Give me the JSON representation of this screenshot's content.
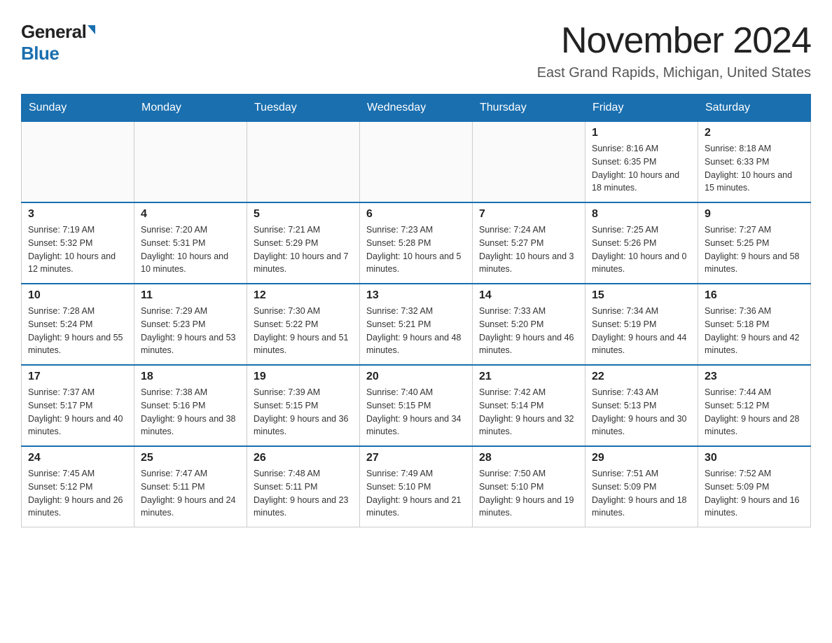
{
  "logo": {
    "general": "General",
    "blue": "Blue"
  },
  "title": "November 2024",
  "subtitle": "East Grand Rapids, Michigan, United States",
  "days_of_week": [
    "Sunday",
    "Monday",
    "Tuesday",
    "Wednesday",
    "Thursday",
    "Friday",
    "Saturday"
  ],
  "weeks": [
    [
      {
        "day": "",
        "info": ""
      },
      {
        "day": "",
        "info": ""
      },
      {
        "day": "",
        "info": ""
      },
      {
        "day": "",
        "info": ""
      },
      {
        "day": "",
        "info": ""
      },
      {
        "day": "1",
        "info": "Sunrise: 8:16 AM\nSunset: 6:35 PM\nDaylight: 10 hours and 18 minutes."
      },
      {
        "day": "2",
        "info": "Sunrise: 8:18 AM\nSunset: 6:33 PM\nDaylight: 10 hours and 15 minutes."
      }
    ],
    [
      {
        "day": "3",
        "info": "Sunrise: 7:19 AM\nSunset: 5:32 PM\nDaylight: 10 hours and 12 minutes."
      },
      {
        "day": "4",
        "info": "Sunrise: 7:20 AM\nSunset: 5:31 PM\nDaylight: 10 hours and 10 minutes."
      },
      {
        "day": "5",
        "info": "Sunrise: 7:21 AM\nSunset: 5:29 PM\nDaylight: 10 hours and 7 minutes."
      },
      {
        "day": "6",
        "info": "Sunrise: 7:23 AM\nSunset: 5:28 PM\nDaylight: 10 hours and 5 minutes."
      },
      {
        "day": "7",
        "info": "Sunrise: 7:24 AM\nSunset: 5:27 PM\nDaylight: 10 hours and 3 minutes."
      },
      {
        "day": "8",
        "info": "Sunrise: 7:25 AM\nSunset: 5:26 PM\nDaylight: 10 hours and 0 minutes."
      },
      {
        "day": "9",
        "info": "Sunrise: 7:27 AM\nSunset: 5:25 PM\nDaylight: 9 hours and 58 minutes."
      }
    ],
    [
      {
        "day": "10",
        "info": "Sunrise: 7:28 AM\nSunset: 5:24 PM\nDaylight: 9 hours and 55 minutes."
      },
      {
        "day": "11",
        "info": "Sunrise: 7:29 AM\nSunset: 5:23 PM\nDaylight: 9 hours and 53 minutes."
      },
      {
        "day": "12",
        "info": "Sunrise: 7:30 AM\nSunset: 5:22 PM\nDaylight: 9 hours and 51 minutes."
      },
      {
        "day": "13",
        "info": "Sunrise: 7:32 AM\nSunset: 5:21 PM\nDaylight: 9 hours and 48 minutes."
      },
      {
        "day": "14",
        "info": "Sunrise: 7:33 AM\nSunset: 5:20 PM\nDaylight: 9 hours and 46 minutes."
      },
      {
        "day": "15",
        "info": "Sunrise: 7:34 AM\nSunset: 5:19 PM\nDaylight: 9 hours and 44 minutes."
      },
      {
        "day": "16",
        "info": "Sunrise: 7:36 AM\nSunset: 5:18 PM\nDaylight: 9 hours and 42 minutes."
      }
    ],
    [
      {
        "day": "17",
        "info": "Sunrise: 7:37 AM\nSunset: 5:17 PM\nDaylight: 9 hours and 40 minutes."
      },
      {
        "day": "18",
        "info": "Sunrise: 7:38 AM\nSunset: 5:16 PM\nDaylight: 9 hours and 38 minutes."
      },
      {
        "day": "19",
        "info": "Sunrise: 7:39 AM\nSunset: 5:15 PM\nDaylight: 9 hours and 36 minutes."
      },
      {
        "day": "20",
        "info": "Sunrise: 7:40 AM\nSunset: 5:15 PM\nDaylight: 9 hours and 34 minutes."
      },
      {
        "day": "21",
        "info": "Sunrise: 7:42 AM\nSunset: 5:14 PM\nDaylight: 9 hours and 32 minutes."
      },
      {
        "day": "22",
        "info": "Sunrise: 7:43 AM\nSunset: 5:13 PM\nDaylight: 9 hours and 30 minutes."
      },
      {
        "day": "23",
        "info": "Sunrise: 7:44 AM\nSunset: 5:12 PM\nDaylight: 9 hours and 28 minutes."
      }
    ],
    [
      {
        "day": "24",
        "info": "Sunrise: 7:45 AM\nSunset: 5:12 PM\nDaylight: 9 hours and 26 minutes."
      },
      {
        "day": "25",
        "info": "Sunrise: 7:47 AM\nSunset: 5:11 PM\nDaylight: 9 hours and 24 minutes."
      },
      {
        "day": "26",
        "info": "Sunrise: 7:48 AM\nSunset: 5:11 PM\nDaylight: 9 hours and 23 minutes."
      },
      {
        "day": "27",
        "info": "Sunrise: 7:49 AM\nSunset: 5:10 PM\nDaylight: 9 hours and 21 minutes."
      },
      {
        "day": "28",
        "info": "Sunrise: 7:50 AM\nSunset: 5:10 PM\nDaylight: 9 hours and 19 minutes."
      },
      {
        "day": "29",
        "info": "Sunrise: 7:51 AM\nSunset: 5:09 PM\nDaylight: 9 hours and 18 minutes."
      },
      {
        "day": "30",
        "info": "Sunrise: 7:52 AM\nSunset: 5:09 PM\nDaylight: 9 hours and 16 minutes."
      }
    ]
  ]
}
